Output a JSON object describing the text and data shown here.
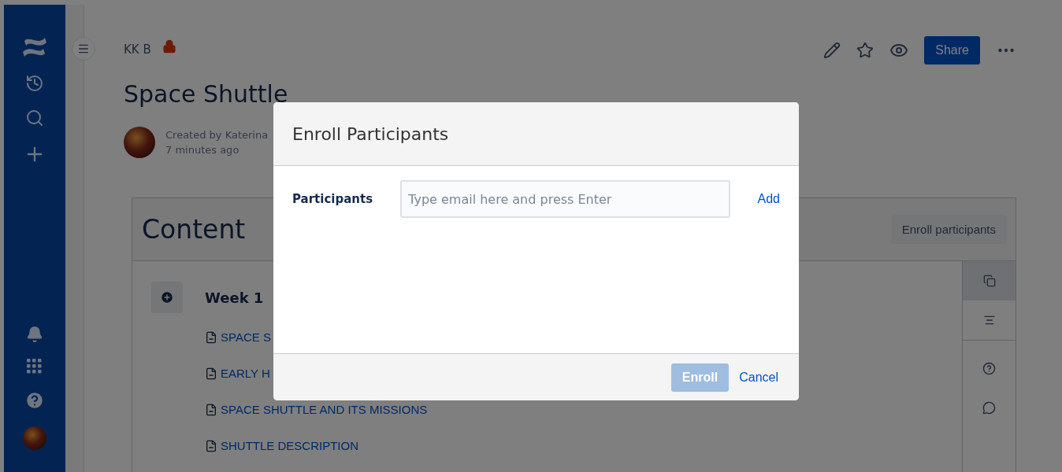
{
  "breadcrumb": {
    "label": "KK B",
    "restricted": true
  },
  "header": {
    "share": "Share"
  },
  "page": {
    "title": "Space Shuttle",
    "byline": [
      "Created by Katerina",
      "7 minutes ago"
    ]
  },
  "content": {
    "title": "Content",
    "enroll_button": "Enroll participants",
    "week": "Week 1",
    "pages": [
      "SPACE S",
      "EARLY H",
      "SPACE SHUTTLE AND ITS MISSIONS",
      "SHUTTLE DESCRIPTION"
    ],
    "tool_tabs": [
      {
        "kind": "copy",
        "selected": true
      },
      {
        "kind": "outline",
        "selected": false
      }
    ]
  },
  "modal": {
    "title": "Enroll Participants",
    "field_label": "Participants",
    "placeholder": "Type email here and press Enter",
    "add": "Add",
    "enroll": {
      "label": "Enroll",
      "disabled": true
    },
    "cancel": "Cancel"
  }
}
